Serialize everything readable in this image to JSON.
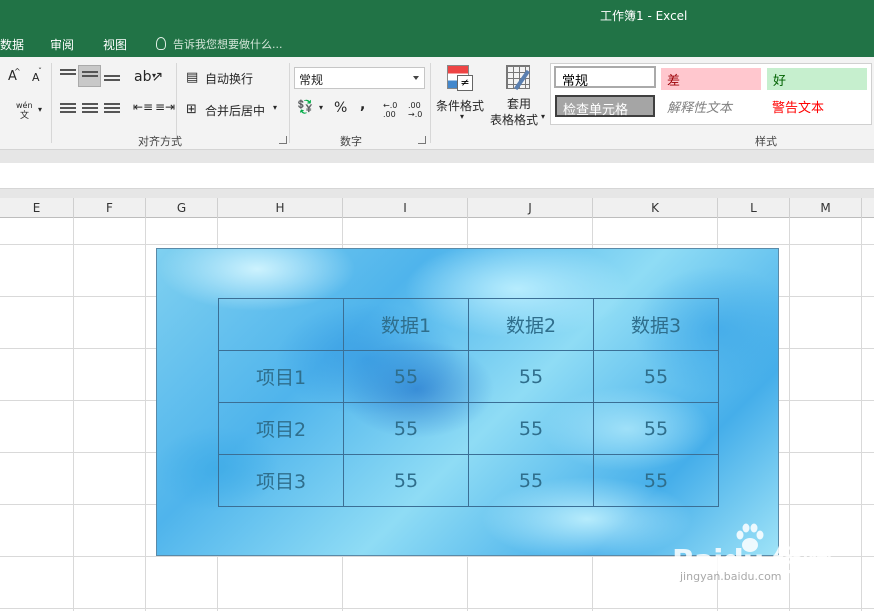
{
  "window": {
    "title": "工作簿1 - Excel"
  },
  "tabs": [
    {
      "label": "数据"
    },
    {
      "label": "审阅"
    },
    {
      "label": "视图"
    }
  ],
  "tell_me": {
    "placeholder": "告诉我您想要做什么..."
  },
  "ribbon": {
    "font_group": {
      "grow_label": "A",
      "shrink_label": "A",
      "phonetic_label": "wén"
    },
    "alignment": {
      "wrap_text": "自动换行",
      "merge_center": "合并后居中",
      "group_label": "对齐方式"
    },
    "number": {
      "format_value": "常规",
      "percent": "%",
      "comma": ",",
      "group_label": "数字"
    },
    "styles": {
      "conditional_formatting": "条件格式",
      "format_as_table_line1": "套用",
      "format_as_table_line2": "表格格式",
      "cells": [
        {
          "label": "常规",
          "bg": "#ffffff",
          "fg": "#000000"
        },
        {
          "label": "差",
          "bg": "#ffc7ce",
          "fg": "#9c0006"
        },
        {
          "label": "好",
          "bg": "#c6efce",
          "fg": "#006100"
        },
        {
          "label": "检查单元格",
          "bg": "#a5a5a5",
          "fg": "#ffffff"
        },
        {
          "label": "解释性文本",
          "bg": "#ffffff",
          "fg": "#7f7f7f"
        },
        {
          "label": "警告文本",
          "bg": "#ffffff",
          "fg": "#ff0000"
        }
      ],
      "group_label": "样式"
    }
  },
  "columns": [
    "E",
    "F",
    "G",
    "H",
    "I",
    "J",
    "K",
    "L",
    "M"
  ],
  "picture_table": {
    "header": [
      "",
      "数据1",
      "数据2",
      "数据3"
    ],
    "rows": [
      [
        "项目1",
        "55",
        "55",
        "55"
      ],
      [
        "项目2",
        "55",
        "55",
        "55"
      ],
      [
        "项目3",
        "55",
        "55",
        "55"
      ]
    ]
  },
  "watermark": {
    "logo": "Baidu 经验",
    "url": "jingyan.baidu.com"
  },
  "colors": {
    "excel_green": "#217346",
    "ribbon_bg": "#f3f3f3"
  }
}
